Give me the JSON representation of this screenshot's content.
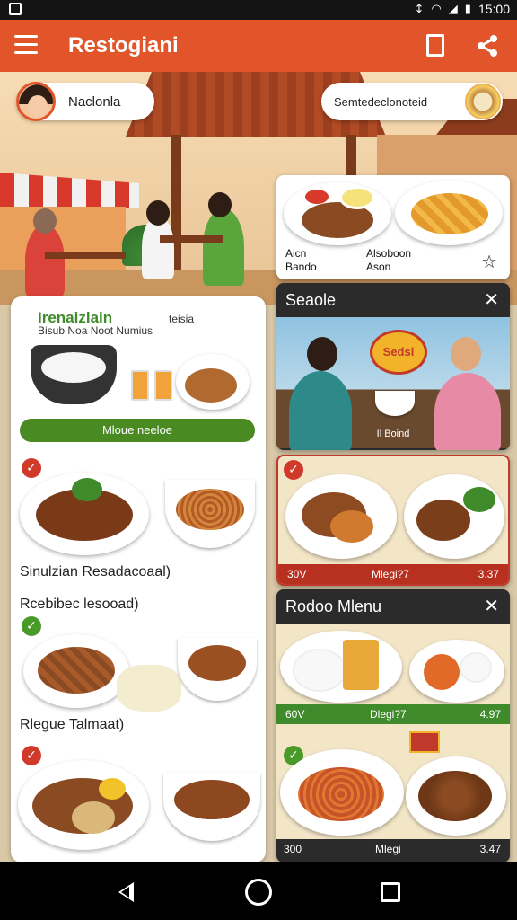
{
  "status_bar": {
    "time": "15:00"
  },
  "app_bar": {
    "title": "Restogiani"
  },
  "hero": {
    "left_pill": "Naclonla",
    "right_pill": "Semtedeclonoteid"
  },
  "featured_card": {
    "left_label_1": "Aicn",
    "left_label_2": "Bando",
    "right_label_1": "Alsoboon",
    "right_label_2": "Ason"
  },
  "left_panel": {
    "title": "Irenaizlain",
    "title_suffix": "teisia",
    "subtitle": "Bisub Noa Noot Numius",
    "button_label": "Mloue neeloe",
    "items": [
      {
        "label": "Sinulzian Resadacoaal)"
      },
      {
        "label": "Rcebibec lesooad)"
      },
      {
        "label": "Rlegue Talmaat)"
      }
    ]
  },
  "search_card": {
    "header": "Seaole",
    "caption": "Il Boind",
    "sign_text": "Sedsi"
  },
  "promo_card": {
    "price_left": "30V",
    "price_mid": "Mlegi?7",
    "price_right": "3.37"
  },
  "menu_card": {
    "header": "Rodoo Mlenu",
    "row1": {
      "left": "60V",
      "mid": "Dlegi?7",
      "right": "4.97"
    },
    "row2": {
      "left": "300",
      "mid": "Mlegi",
      "right": "3.47"
    }
  },
  "colors": {
    "accent": "#e2542a",
    "green": "#4a8a22",
    "red": "#c0392b",
    "dark": "#2b2b2b"
  }
}
